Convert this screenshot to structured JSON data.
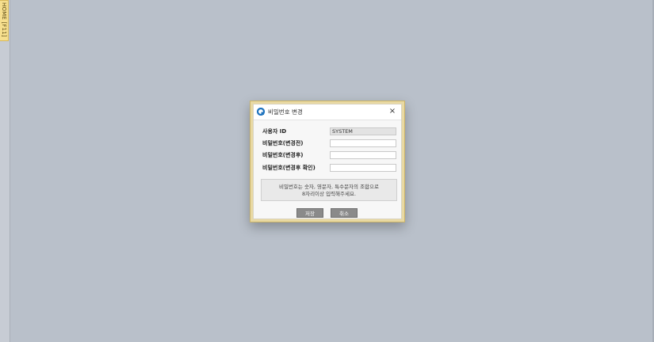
{
  "side_tab": {
    "label": "HOME [F11]"
  },
  "dialog": {
    "title": "비밀번호 변경",
    "close_glyph": "×",
    "fields": [
      {
        "label": "사용자 ID",
        "value": "SYSTEM",
        "placeholder": ""
      },
      {
        "label": "비밀번호(변경전)",
        "value": "",
        "placeholder": ""
      },
      {
        "label": "비밀번호(변경후)",
        "value": "",
        "placeholder": ""
      },
      {
        "label": "비밀번호(변경후 확인)",
        "value": "",
        "placeholder": ""
      }
    ],
    "notice_line1": "비밀번호는 숫자, 영문자, 특수문자의 조합으로",
    "notice_line2": "8자리이상 입력해주세요.",
    "save_label": "저장",
    "cancel_label": "취소"
  },
  "colors": {
    "background": "#b9c0ca",
    "dialog_border": "#e9d9a3",
    "button": "#8a8a8a",
    "tab": "#f6df8e",
    "icon_accent": "#1e73be"
  }
}
